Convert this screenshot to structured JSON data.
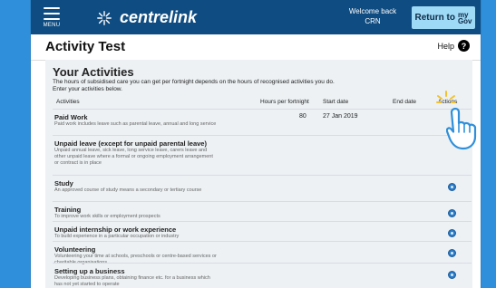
{
  "header": {
    "menu_label": "MENU",
    "brand": "centrelink",
    "welcome_line1": "Welcome back",
    "welcome_line2": "CRN",
    "return_label": "Return to",
    "return_my": "my",
    "return_gov": "Gov"
  },
  "page": {
    "title": "Activity Test",
    "help_label": "Help",
    "help_icon": "?"
  },
  "activities": {
    "heading": "Your Activities",
    "intro_line1": "The hours of subsidised care you can get per fortnight depends on the hours of recognised activities you do.",
    "intro_line2": "Enter your activities below.",
    "columns": {
      "activities": "Activities",
      "hours": "Hours per fortnight",
      "start": "Start date",
      "end": "End date",
      "actions": "Actions"
    },
    "rows": [
      {
        "title": "Paid Work",
        "desc": "Paid work includes leave such as parental leave, annual and long service",
        "hours": "80",
        "start": "27 Jan 2019"
      },
      {
        "title": "Unpaid leave (except for unpaid parental leave)",
        "desc": "Unpaid annual leave, sick leave, long service leave, carers leave and other unpaid leave where a formal or ongoing employment arrangement or contract is in place",
        "hours": "",
        "start": ""
      },
      {
        "title": "Study",
        "desc": "An approved course of study means a secondary or tertiary course",
        "hours": "",
        "start": ""
      },
      {
        "title": "Training",
        "desc": "To improve work skills or employment prospects",
        "hours": "",
        "start": ""
      },
      {
        "title": "Unpaid internship or work experience",
        "desc": "To build experience in a particular occupation or industry",
        "hours": "",
        "start": ""
      },
      {
        "title": "Volunteering",
        "desc": "Volunteering your time at schools, preschools or centre-based services or charitable organisations",
        "hours": "",
        "start": ""
      },
      {
        "title": "Setting up a business",
        "desc": "Developing business plans, obtaining finance etc. for a business which has not yet started to operate",
        "hours": "",
        "start": ""
      }
    ]
  },
  "colors": {
    "header_bg": "#0f4c81",
    "page_bg": "#2f8fda",
    "panel_bg": "#edf1f4",
    "return_btn": "#9ed9f6",
    "action_icon": "#2b7cc7"
  }
}
